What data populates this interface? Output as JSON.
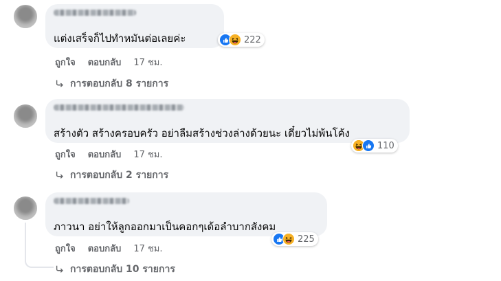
{
  "comments": [
    {
      "text": "แต่งเสร็จก็ไปทำหมันต่อเลยค่ะ",
      "reaction_count": "222",
      "reactions": [
        "like",
        "haha"
      ],
      "actions": {
        "like": "ถูกใจ",
        "reply": "ตอบกลับ",
        "time": "17 ชม."
      },
      "replies_label": "การตอบกลับ 8 รายการ"
    },
    {
      "text": "สร้างตัว สร้างครอบครัว อย่าลืมสร้างช่วงล่างด้วยนะ เดี๋ยวไม่พ้นโค้ง",
      "reaction_count": "110",
      "reactions": [
        "haha",
        "like"
      ],
      "actions": {
        "like": "ถูกใจ",
        "reply": "ตอบกลับ",
        "time": "17 ชม."
      },
      "replies_label": "การตอบกลับ 2 รายการ"
    },
    {
      "text": "ภาวนา อย่าให้ลูกออกมาเป็นคอกๆเด้อลำบากสังคม",
      "reaction_count": "225",
      "reactions": [
        "like",
        "haha"
      ],
      "actions": {
        "like": "ถูกใจ",
        "reply": "ตอบกลับ",
        "time": "17 ชม."
      },
      "replies_label": "การตอบกลับ 10 รายการ"
    }
  ],
  "colors": {
    "like": "#1877f2",
    "haha": "#f7b125",
    "bubble": "#f0f2f5",
    "meta": "#65676b"
  },
  "icons": {
    "like": "thumbs-up-icon",
    "haha": "laughing-face-icon",
    "reply_arrow": "reply-arrow-icon"
  }
}
